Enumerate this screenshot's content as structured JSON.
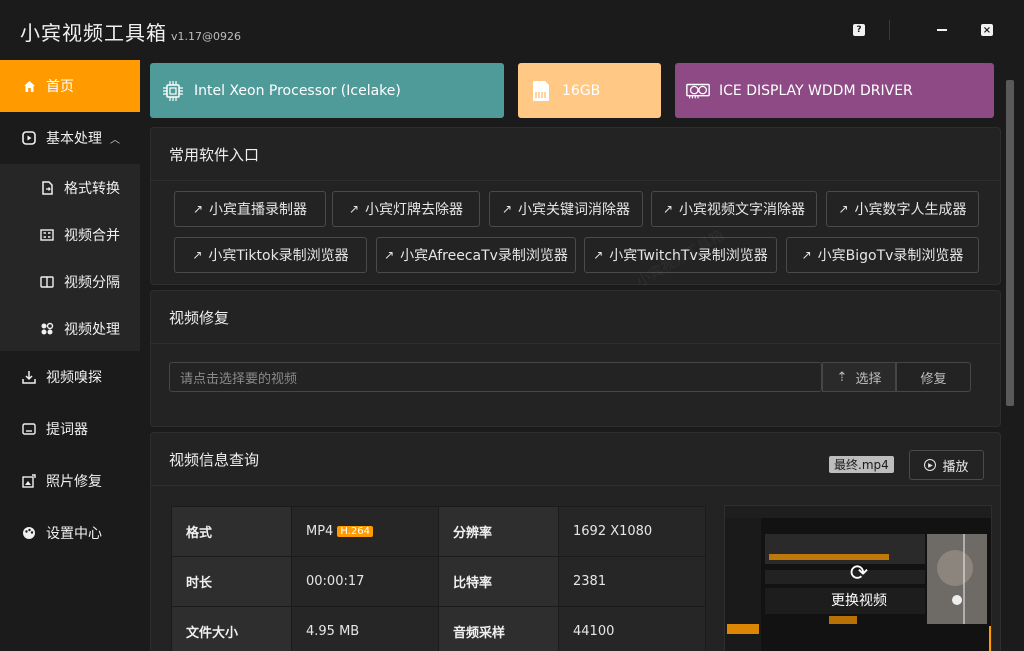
{
  "app": {
    "title": "小宾视频工具箱",
    "version": "v1.17@0926"
  },
  "window": {
    "help": "?",
    "close": "×"
  },
  "sidebar": {
    "items": [
      {
        "label": "首页",
        "icon": "home-icon",
        "active": true
      },
      {
        "label": "基本处理",
        "icon": "play-box-icon",
        "expanded": true
      },
      {
        "label": "格式转换",
        "icon": "file-convert-icon",
        "sub": true
      },
      {
        "label": "视频合并",
        "icon": "merge-icon",
        "sub": true
      },
      {
        "label": "视频分隔",
        "icon": "split-icon",
        "sub": true
      },
      {
        "label": "视频处理",
        "icon": "process-icon",
        "sub": true
      },
      {
        "label": "视频嗅探",
        "icon": "download-icon"
      },
      {
        "label": "提词器",
        "icon": "teleprompter-icon"
      },
      {
        "label": "照片修复",
        "icon": "photo-repair-icon"
      },
      {
        "label": "设置中心",
        "icon": "settings-icon"
      }
    ]
  },
  "hardware": {
    "cpu": "Intel Xeon Processor (Icelake)",
    "memory": "16GB",
    "gpu": "ICE DISPLAY WDDM DRIVER",
    "colors": {
      "cpu": "#4e9b9a",
      "memory": "#ffc985",
      "gpu": "#8e4a85"
    }
  },
  "software": {
    "title": "常用软件入口",
    "arrow": "↗",
    "items": [
      "小宾直播录制器",
      "小宾灯牌去除器",
      "小宾关键词消除器",
      "小宾视频文字消除器",
      "小宾数字人生成器",
      "小宾Tiktok录制浏览器",
      "小宾AfreecaTv录制浏览器",
      "小宾TwitchTv录制浏览器",
      "小宾BigoTv录制浏览器"
    ]
  },
  "repair": {
    "title": "视频修复",
    "placeholder": "请点击选择要的视频",
    "choose": "选择",
    "repair": "修复"
  },
  "info": {
    "title": "视频信息查询",
    "file_tag": "最终.mp4",
    "play": "播放",
    "rows": [
      {
        "k1": "格式",
        "v1": "MP4",
        "codec": "H.264",
        "k2": "分辨率",
        "v2": "1692 X1080"
      },
      {
        "k1": "时长",
        "v1": "00:00:17",
        "k2": "比特率",
        "v2": "2381"
      },
      {
        "k1": "文件大小",
        "v1": "4.95 MB",
        "k2": "音频采样",
        "v2": "44100"
      }
    ],
    "preview_action": "更换视频"
  },
  "accent": "#ff9a00"
}
